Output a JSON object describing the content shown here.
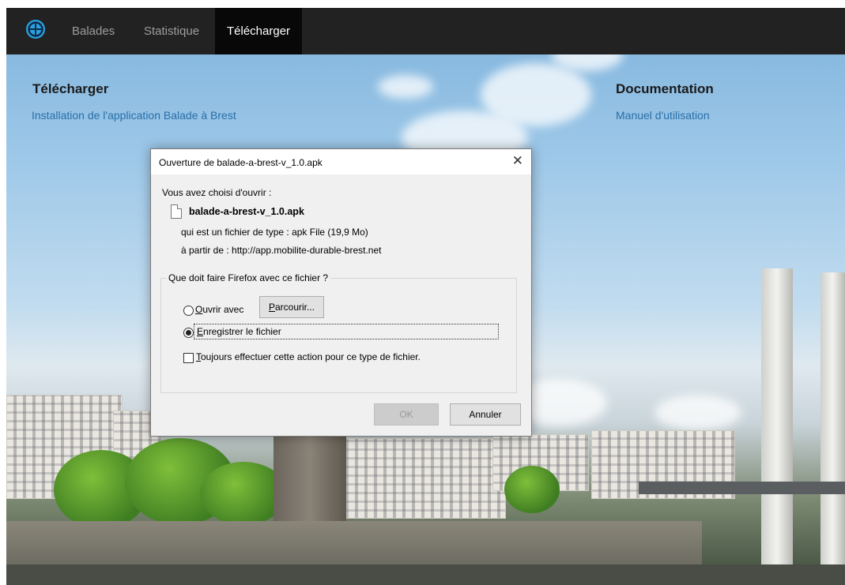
{
  "navbar": {
    "logo_icon": "map-logo-icon",
    "items": [
      {
        "label": "Balades",
        "active": false
      },
      {
        "label": "Statistique",
        "active": false
      },
      {
        "label": "Télécharger",
        "active": true
      }
    ]
  },
  "left_panel": {
    "title": "Télécharger",
    "link": "Installation de l'application Balade à Brest"
  },
  "right_panel": {
    "title": "Documentation",
    "link": "Manuel d'utilisation"
  },
  "dialog": {
    "title": "Ouverture de balade-a-brest-v_1.0.apk",
    "close_icon": "close-icon",
    "intro": "Vous avez choisi d'ouvrir :",
    "file_name": "balade-a-brest-v_1.0.apk",
    "type_line": "qui est un fichier de type : apk File (19,9 Mo)",
    "from_line": "à partir de : http://app.mobilite-durable-brest.net",
    "group_legend": "Que doit faire Firefox avec ce fichier ?",
    "open_with_accesskey": "O",
    "open_with_rest": "uvrir avec",
    "browse_accesskey": "P",
    "browse_rest": "arcourir...",
    "save_accesskey": "E",
    "save_rest": "nregistrer le fichier",
    "always_accesskey": "T",
    "always_rest": "oujours effectuer cette action pour ce type de fichier.",
    "selected_option": "save",
    "always_checked": false,
    "ok_label": "OK",
    "cancel_label": "Annuler"
  }
}
